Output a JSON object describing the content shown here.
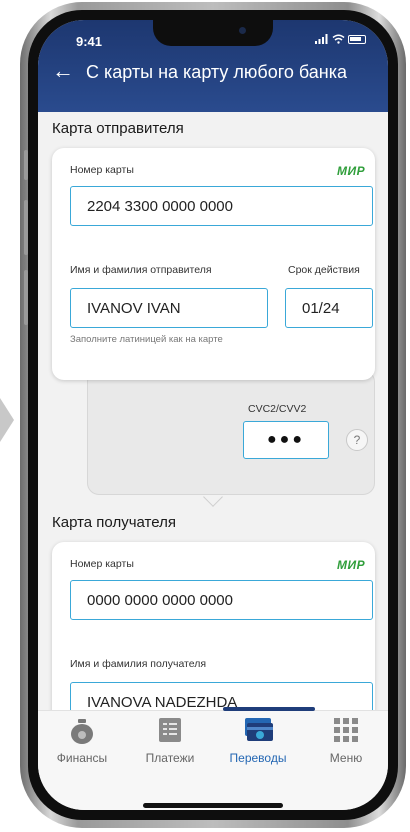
{
  "status": {
    "time": "9:41"
  },
  "header": {
    "title": "С карты на карту любого банка"
  },
  "sender": {
    "section_title": "Карта отправителя",
    "card_number_label": "Номер карты",
    "card_number": "2204 3300 0000 0000",
    "payment_system": "МИР",
    "name_label": "Имя и фамилия отправителя",
    "name_value": "IVANOV IVAN",
    "expiry_label": "Срок действия",
    "expiry_value": "01/24",
    "hint": "Заполните латиницей как на карте",
    "cvc_label": "CVC2/CVV2",
    "cvc_value": "●●●",
    "help": "?"
  },
  "recipient": {
    "section_title": "Карта получателя",
    "card_number_label": "Номер карты",
    "card_number": "0000 0000 0000 0000",
    "payment_system": "МИР",
    "name_label": "Имя и фамилия получателя",
    "name_value": "IVANOVA NADEZHDA"
  },
  "tabs": [
    {
      "label": "Финансы",
      "icon": "money-bag-icon",
      "active": false
    },
    {
      "label": "Платежи",
      "icon": "receipt-icon",
      "active": false
    },
    {
      "label": "Переводы",
      "icon": "card-transfer-icon",
      "active": true
    },
    {
      "label": "Меню",
      "icon": "grid-icon",
      "active": false
    }
  ],
  "colors": {
    "header": "#1f3d7a",
    "accent": "#3aa8d8",
    "mir_green": "#2f9e3a",
    "active_tab": "#2467b3"
  }
}
